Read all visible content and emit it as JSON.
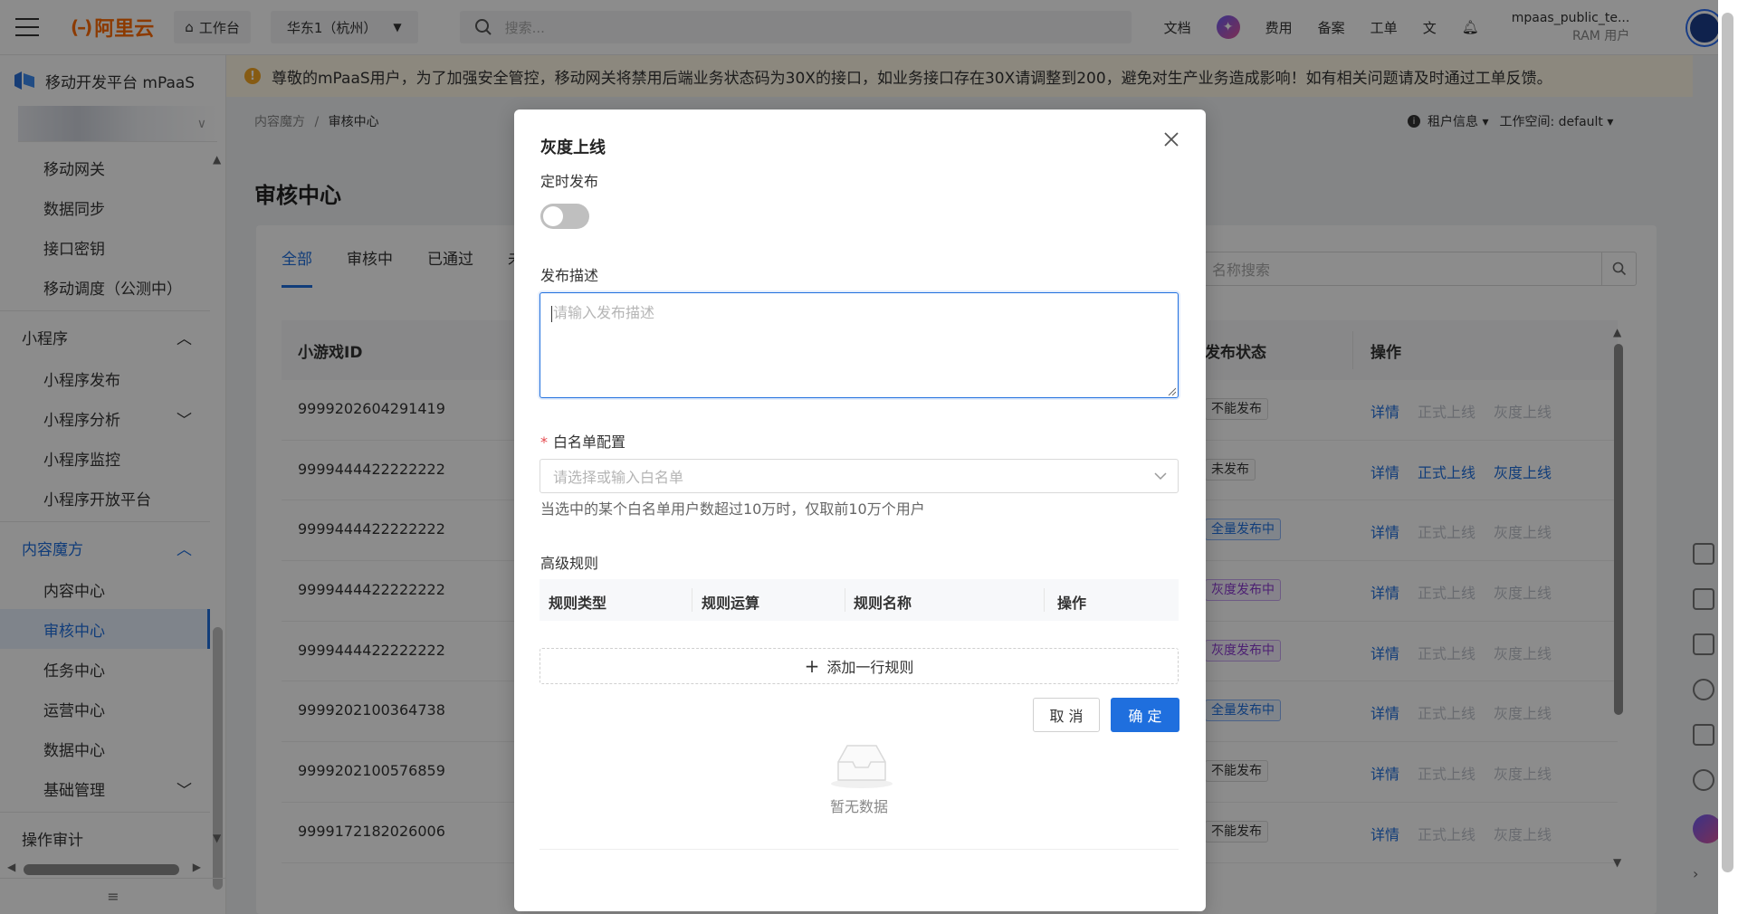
{
  "topbar": {
    "logo": "阿里云",
    "workbench": "工作台",
    "region": "华东1（杭州）",
    "search_placeholder": "搜索...",
    "nav": [
      "文档",
      "费用",
      "备案",
      "工单"
    ],
    "user_name": "mpaas_public_te...",
    "user_role": "RAM 用户"
  },
  "sidebar": {
    "product": "移动开发平台 mPaaS",
    "items_top": [
      "移动网关",
      "数据同步",
      "接口密钥",
      "移动调度（公测中）"
    ],
    "group_miniapp": "小程序",
    "miniapp_items": [
      "小程序发布",
      "小程序分析",
      "小程序监控",
      "小程序开放平台"
    ],
    "group_content": "内容魔方",
    "content_items": [
      "内容中心",
      "审核中心",
      "任务中心",
      "运营中心",
      "数据中心",
      "基础管理"
    ],
    "audit": "操作审计"
  },
  "notice": "尊敬的mPaaS用户，为了加强安全管控，移动网关将禁用后端业务状态码为30X的接口，如业务接口存在30X请调整到200，避免对生产业务造成影响！如有相关问题请及时通过工单反馈。",
  "breadcrumb": {
    "parent": "内容魔方",
    "sep": "/",
    "current": "审核中心"
  },
  "tenant": {
    "info": "租户信息",
    "workspace": "工作空间: default"
  },
  "page_title": "审核中心",
  "tabs": [
    "全部",
    "审核中",
    "已通过",
    "未"
  ],
  "name_search_placeholder": "名称搜索",
  "table": {
    "headers": {
      "id": "小游戏ID",
      "status": "发布状态",
      "op": "操作"
    },
    "rows": [
      {
        "id": "9999202604291419",
        "status": "不能发布",
        "style": "gray",
        "ops_enabled": [
          true,
          false,
          false
        ]
      },
      {
        "id": "9999444422222222",
        "status": "未发布",
        "style": "gray",
        "ops_enabled": [
          true,
          true,
          true
        ]
      },
      {
        "id": "9999444422222222",
        "status": "全量发布中",
        "style": "blue",
        "ops_enabled": [
          true,
          false,
          false
        ]
      },
      {
        "id": "9999444422222222",
        "status": "灰度发布中",
        "style": "purple",
        "ops_enabled": [
          true,
          false,
          false
        ]
      },
      {
        "id": "9999444422222222",
        "status": "灰度发布中",
        "style": "purple",
        "ops_enabled": [
          true,
          false,
          false
        ]
      },
      {
        "id": "9999202100364738",
        "status": "全量发布中",
        "style": "blue",
        "ops_enabled": [
          true,
          false,
          false
        ]
      },
      {
        "id": "9999202100576859",
        "status": "不能发布",
        "style": "gray",
        "ops_enabled": [
          true,
          false,
          false
        ]
      },
      {
        "id": "9999172182026006",
        "status": "不能发布",
        "style": "gray",
        "ops_enabled": [
          true,
          false,
          false
        ]
      }
    ],
    "op_labels": [
      "详情",
      "正式上线",
      "灰度上线"
    ]
  },
  "modal": {
    "title": "灰度上线",
    "schedule_label": "定时发布",
    "schedule_on": false,
    "desc_label": "发布描述",
    "desc_placeholder": "请输入发布描述",
    "whitelist_label": "白名单配置",
    "whitelist_placeholder": "请选择或输入白名单",
    "whitelist_hint": "当选中的某个白名单用户数超过10万时，仅取前10万个用户",
    "advanced_label": "高级规则",
    "rule_headers": [
      "规则类型",
      "规则运算",
      "规则名称",
      "操作"
    ],
    "empty_text": "暂无数据",
    "add_rule": "添加一行规则",
    "cancel": "取 消",
    "ok": "确 定"
  }
}
